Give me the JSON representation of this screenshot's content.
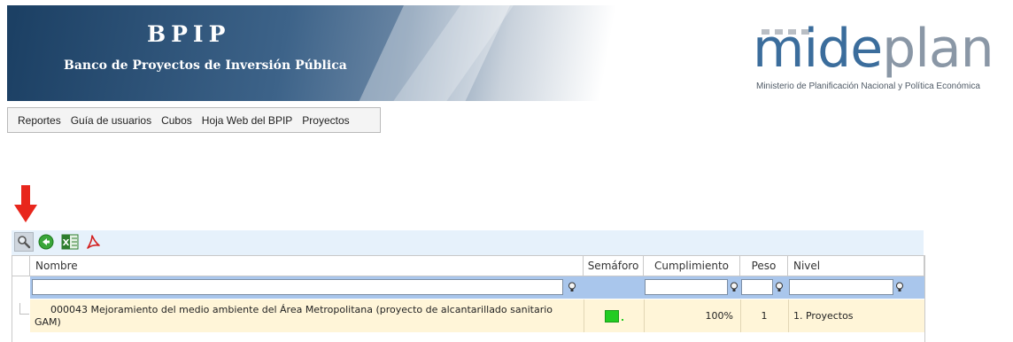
{
  "banner": {
    "title": "BPIP",
    "subtitle": "Banco de Proyectos de Inversión Pública",
    "logo_main": "mide",
    "logo_accent": "plan",
    "tagline": "Ministerio de Planificación Nacional y Política Económica"
  },
  "menu": {
    "items": [
      "Reportes",
      "Guía de usuarios",
      "Cubos",
      "Hoja Web del BPIP",
      "Proyectos"
    ]
  },
  "toolbar": {
    "icons": [
      "search-icon",
      "back-icon",
      "excel-icon",
      "pdf-icon"
    ],
    "arrow_color": "#e8261c"
  },
  "grid": {
    "columns": [
      "Nombre",
      "Semáforo",
      "Cumplimiento",
      "Peso",
      "Nivel"
    ],
    "filters": {
      "nombre": "",
      "cumplimiento": "",
      "peso": "",
      "nivel": ""
    },
    "rows": [
      {
        "nombre": "000043 Mejoramiento del medio ambiente del Área Metropolitana (proyecto de alcantarillado sanitario GAM)",
        "semaforo_color": "#22cc22",
        "cumplimiento": "100%",
        "peso": "1",
        "nivel": "1. Proyectos"
      }
    ]
  }
}
